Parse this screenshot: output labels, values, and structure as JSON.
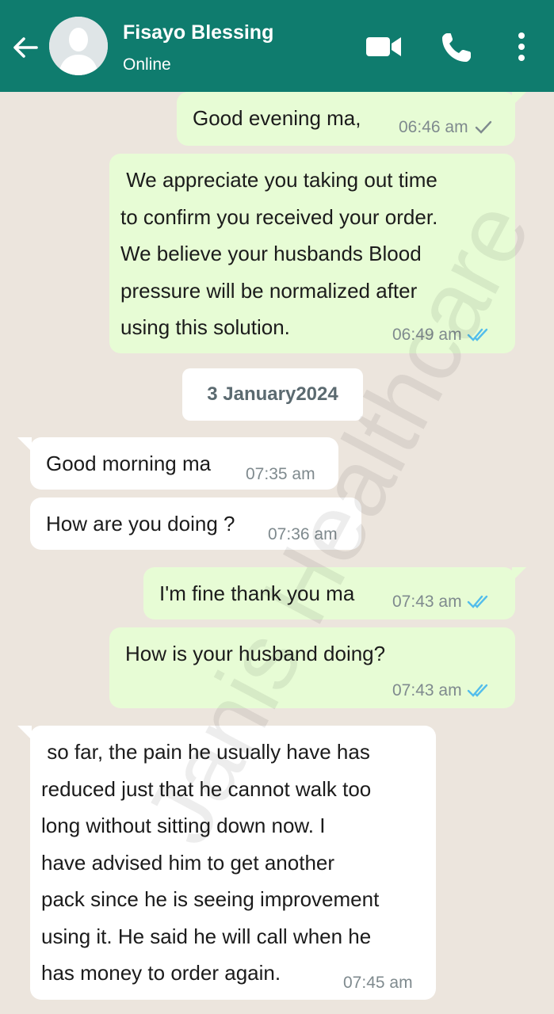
{
  "header": {
    "contact_name": "Fisayo Blessing",
    "status": "Online",
    "back_icon": "arrow-left-icon",
    "video_icon": "video-camera-icon",
    "call_icon": "phone-icon",
    "menu_icon": "more-vertical-icon",
    "color": "#0f7c6e"
  },
  "date_divider": "3 January2024",
  "watermark": "Janis Healthcare",
  "messages": [
    {
      "direction": "out",
      "text": "Good evening ma,",
      "time": "06:46 am",
      "status": "sent"
    },
    {
      "direction": "out",
      "text": " We appreciate you taking out time\nto confirm you received your order.\nWe believe your husbands Blood\npressure will be normalized after\nusing this solution.",
      "time": "06:49 am",
      "status": "read"
    },
    {
      "direction": "in",
      "text": "Good morning ma",
      "time": "07:35 am"
    },
    {
      "direction": "in",
      "text": "How are you doing ?",
      "time": "07:36 am"
    },
    {
      "direction": "out",
      "text": "I'm fine thank you ma",
      "time": "07:43 am",
      "status": "read"
    },
    {
      "direction": "out",
      "text": "How is your husband doing?",
      "time": "07:43 am",
      "status": "read"
    },
    {
      "direction": "in",
      "text": " so far, the pain he usually have has\nreduced just that he cannot walk too\nlong without sitting down now. I\nhave advised him to get another\npack since he is seeing improvement\nusing it. He said he will call when he\nhas money to order again.",
      "time": "07:45 am"
    }
  ],
  "colors": {
    "outgoing_bubble": "#e7fcd5",
    "incoming_bubble": "#ffffff",
    "read_tick": "#53bdeb",
    "sent_tick": "#7f8a8e",
    "chat_background": "#ece5dd"
  }
}
